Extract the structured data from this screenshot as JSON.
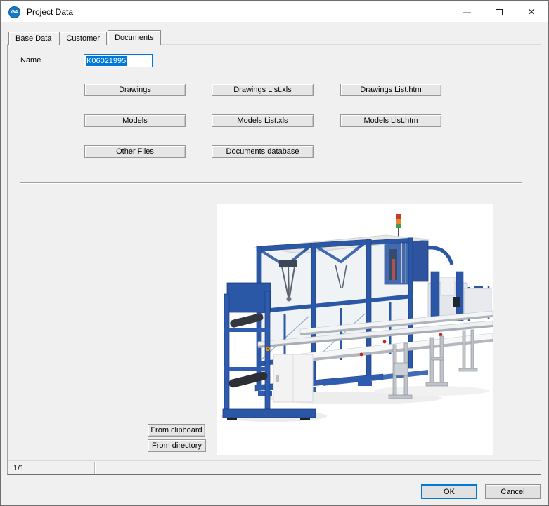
{
  "window": {
    "title": "Project Data",
    "icon_label": "G4"
  },
  "tabs": [
    {
      "label": "Base Data"
    },
    {
      "label": "Customer"
    },
    {
      "label": "Documents"
    }
  ],
  "active_tab": "Documents",
  "form": {
    "name_label": "Name",
    "name_value": "K06021995"
  },
  "doc_buttons": {
    "drawings": "Drawings",
    "drawings_xls": "Drawings List.xls",
    "drawings_htm": "Drawings List.htm",
    "models": "Models",
    "models_xls": "Models List.xls",
    "models_htm": "Models List.htm",
    "other_files": "Other Files",
    "documents_database": "Documents database"
  },
  "image_panel": {
    "from_clipboard": "From clipboard",
    "from_directory": "From directory",
    "photo_subject": "Blue industrial packaging machine line with conveyors"
  },
  "status_bar": {
    "page_indicator": "1/1"
  },
  "dialog_buttons": {
    "ok": "OK",
    "cancel": "Cancel"
  },
  "colors": {
    "accent": "#0078d7",
    "selection_bg": "#0078d7",
    "titlebar_bg": "#ffffff",
    "dialog_bg": "#f0f0f0",
    "machine_blue": "#2b57a7"
  }
}
